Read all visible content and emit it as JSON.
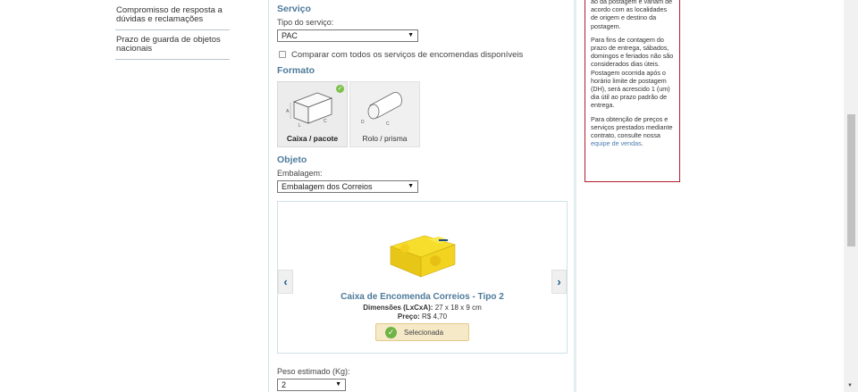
{
  "sidebar": {
    "items": [
      {
        "label": "Compromisso de resposta a dúvidas e reclamações"
      },
      {
        "label": "Prazo de guarda de objetos nacionais"
      }
    ]
  },
  "servico": {
    "title": "Serviço",
    "tipo_label": "Tipo do serviço:",
    "tipo_value": "PAC",
    "compare_label": "Comparar com todos os serviços de encomendas disponíveis"
  },
  "formato": {
    "title": "Formato",
    "options": [
      {
        "label": "Caixa / pacote",
        "selected": true
      },
      {
        "label": "Rolo / prisma",
        "selected": false
      }
    ],
    "dim_letters": {
      "a": "A",
      "l": "L",
      "c": "C",
      "d": "D"
    }
  },
  "objeto": {
    "title": "Objeto",
    "embalagem_label": "Embalagem:",
    "embalagem_value": "Embalagem dos Correios",
    "product": {
      "title": "Caixa de Encomenda Correios - Tipo 2",
      "dim_label": "Dimensões (LxCxA):",
      "dim_value": "27 x 18 x 9 cm",
      "price_label": "Preço:",
      "price_value": "R$ 4,70",
      "selected_label": "Selecionada",
      "prev_icon": "chevron-left-icon",
      "next_icon": "chevron-right-icon"
    },
    "peso_label": "Peso estimado (Kg):",
    "peso_value": "2"
  },
  "info": {
    "p1": "ao da postagem e variam de acordo com as localidades de origem e destino da postagem.",
    "p2": "Para fins de contagem do prazo de entrega, sábados, domingos e feriados não são considerados dias úteis. Postagem ocorrida após o horário limite de postagem (DH), será acrescido 1 (um) dia útil ao prazo padrão de entrega.",
    "p3_text": "Para obtenção de preços e serviços prestados mediante contrato, consulte nossa ",
    "p3_link": "equipe de vendas",
    "p3_end": "."
  },
  "colors": {
    "section_title": "#4d7a9a",
    "info_border": "#b31b2b",
    "link": "#4a7db0",
    "selected_badge": "#7cc04b"
  }
}
